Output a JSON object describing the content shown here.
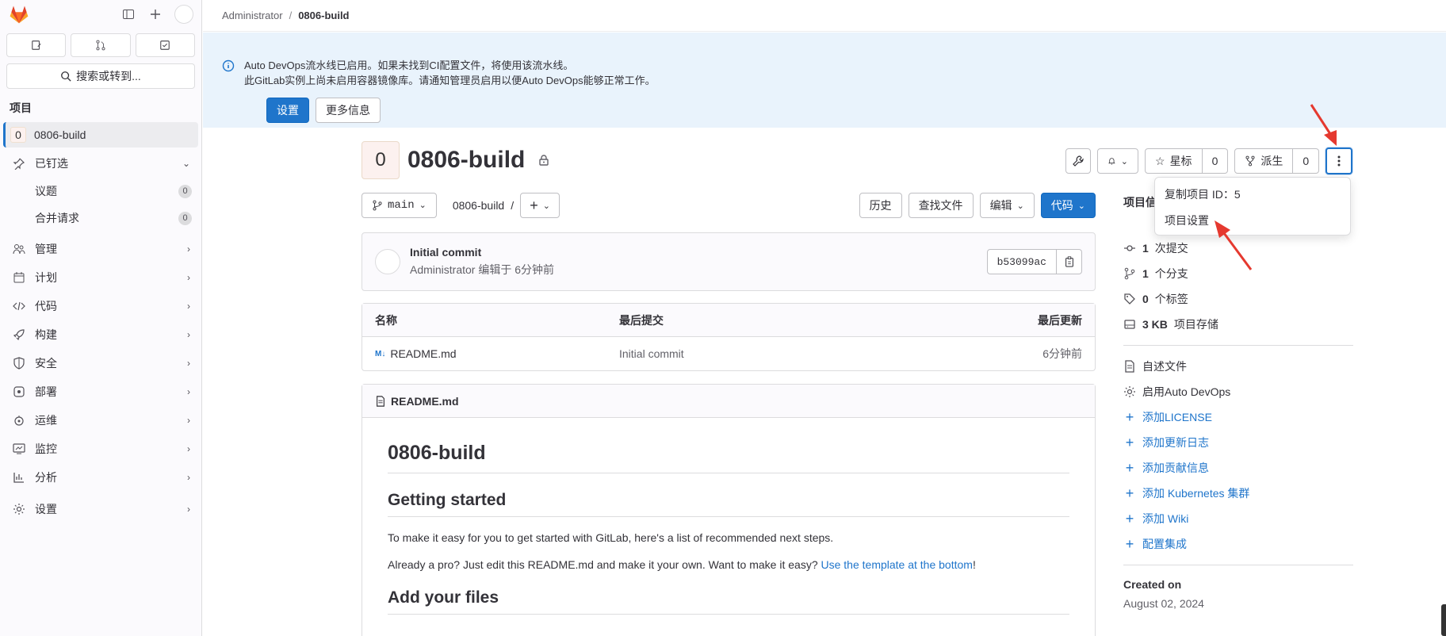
{
  "sidebar": {
    "search_placeholder": "搜索或转到...",
    "section_title": "项目",
    "project_initial": "0",
    "project_name": "0806-build",
    "pinned": {
      "label": "已钉选",
      "items": [
        {
          "label": "议题",
          "count": "0"
        },
        {
          "label": "合并请求",
          "count": "0"
        }
      ]
    },
    "nav": [
      {
        "label": "管理",
        "icon": "users-icon"
      },
      {
        "label": "计划",
        "icon": "calendar-icon"
      },
      {
        "label": "代码",
        "icon": "code-icon"
      },
      {
        "label": "构建",
        "icon": "rocket-icon"
      },
      {
        "label": "安全",
        "icon": "shield-icon"
      },
      {
        "label": "部署",
        "icon": "deploy-icon"
      },
      {
        "label": "运维",
        "icon": "monitor-icon"
      },
      {
        "label": "监控",
        "icon": "chart-icon"
      },
      {
        "label": "分析",
        "icon": "analytics-icon"
      }
    ],
    "settings_label": "设置"
  },
  "breadcrumb": {
    "parent": "Administrator",
    "current": "0806-build"
  },
  "banner": {
    "line1": "Auto DevOps流水线已启用。如果未找到CI配置文件，将使用该流水线。",
    "line2": "此GitLab实例上尚未启用容器镜像库。请通知管理员启用以便Auto DevOps能够正常工作。",
    "primary_btn": "设置",
    "secondary_btn": "更多信息"
  },
  "project": {
    "initial": "0",
    "title": "0806-build",
    "star_label": "星标",
    "star_count": "0",
    "fork_label": "派生",
    "fork_count": "0"
  },
  "dropdown": {
    "items": [
      "复制项目 ID：5",
      "项目设置"
    ]
  },
  "repo": {
    "branch": "main",
    "path": "0806-build",
    "path_sep": "/",
    "history_btn": "历史",
    "find_file_btn": "查找文件",
    "edit_btn": "编辑",
    "code_btn": "代码"
  },
  "commit": {
    "title": "Initial commit",
    "meta": "Administrator 编辑于 6分钟前",
    "sha": "b53099ac"
  },
  "file_table": {
    "headers": {
      "name": "名称",
      "last_commit": "最后提交",
      "last_update": "最后更新"
    },
    "rows": [
      {
        "icon": "M↓",
        "name": "README.md",
        "commit": "Initial commit",
        "updated": "6分钟前"
      }
    ]
  },
  "readme": {
    "filename": "README.md",
    "h1": "0806-build",
    "h2a": "Getting started",
    "p1": "To make it easy for you to get started with GitLab, here's a list of recommended next steps.",
    "p2_prefix": "Already a pro? Just edit this README.md and make it your own. Want to make it easy? ",
    "p2_link": "Use the template at the bottom",
    "p2_suffix": "!",
    "h2b": "Add your files"
  },
  "aside": {
    "title": "项目信",
    "stats": [
      {
        "bold": "1",
        "text": "次提交"
      },
      {
        "bold": "1",
        "text": "个分支"
      },
      {
        "bold": "0",
        "text": "个标签"
      },
      {
        "bold": "3 KB",
        "text": "项目存储"
      }
    ],
    "readme_label": "自述文件",
    "autodevops_label": "启用Auto DevOps",
    "links": [
      "添加LICENSE",
      "添加更新日志",
      "添加贡献信息",
      "添加 Kubernetes 集群",
      "添加 Wiki",
      "配置集成"
    ],
    "created_label": "Created on",
    "created_value": "August 02, 2024"
  },
  "colors": {
    "accent": "#1f75cb",
    "banner_bg": "#e9f3fc",
    "arrow": "#e5392f"
  }
}
